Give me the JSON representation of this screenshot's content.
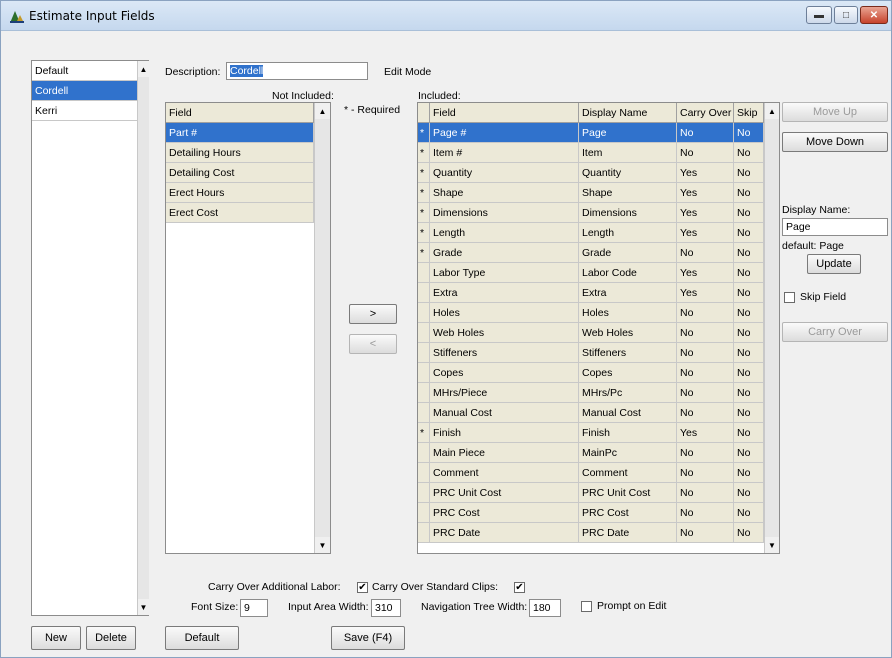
{
  "window": {
    "title": "Estimate Input Fields"
  },
  "templates": {
    "items": [
      "Default",
      "Cordell",
      "Kerri"
    ],
    "selected_index": 1
  },
  "description": {
    "label": "Description:",
    "value": "Cordell",
    "mode": "Edit Mode"
  },
  "not_included": {
    "label": "Not Included:",
    "header": "Field",
    "items": [
      "Part #",
      "Detailing Hours",
      "Detailing Cost",
      "Erect Hours",
      "Erect Cost"
    ],
    "selected_index": 0
  },
  "required_note": "* - Required",
  "move_buttons": {
    "include": ">",
    "exclude": "<"
  },
  "included": {
    "label": "Included:",
    "headers": [
      "Field",
      "Display Name",
      "Carry Over",
      "Skip"
    ],
    "rows": [
      {
        "req": "*",
        "field": "Page #",
        "display": "Page",
        "carry": "No",
        "skip": "No"
      },
      {
        "req": "*",
        "field": "Item #",
        "display": "Item",
        "carry": "No",
        "skip": "No"
      },
      {
        "req": "*",
        "field": "Quantity",
        "display": "Quantity",
        "carry": "Yes",
        "skip": "No"
      },
      {
        "req": "*",
        "field": "Shape",
        "display": "Shape",
        "carry": "Yes",
        "skip": "No"
      },
      {
        "req": "*",
        "field": "Dimensions",
        "display": "Dimensions",
        "carry": "Yes",
        "skip": "No"
      },
      {
        "req": "*",
        "field": "Length",
        "display": "Length",
        "carry": "Yes",
        "skip": "No"
      },
      {
        "req": "*",
        "field": "Grade",
        "display": "Grade",
        "carry": "No",
        "skip": "No"
      },
      {
        "req": "",
        "field": "Labor Type",
        "display": "Labor Code",
        "carry": "Yes",
        "skip": "No"
      },
      {
        "req": "",
        "field": "Extra",
        "display": "Extra",
        "carry": "Yes",
        "skip": "No"
      },
      {
        "req": "",
        "field": "Holes",
        "display": "Holes",
        "carry": "No",
        "skip": "No"
      },
      {
        "req": "",
        "field": "Web Holes",
        "display": "Web Holes",
        "carry": "No",
        "skip": "No"
      },
      {
        "req": "",
        "field": "Stiffeners",
        "display": "Stiffeners",
        "carry": "No",
        "skip": "No"
      },
      {
        "req": "",
        "field": "Copes",
        "display": "Copes",
        "carry": "No",
        "skip": "No"
      },
      {
        "req": "",
        "field": "MHrs/Piece",
        "display": "MHrs/Pc",
        "carry": "No",
        "skip": "No"
      },
      {
        "req": "",
        "field": "Manual Cost",
        "display": "Manual Cost",
        "carry": "No",
        "skip": "No"
      },
      {
        "req": "*",
        "field": "Finish",
        "display": "Finish",
        "carry": "Yes",
        "skip": "No"
      },
      {
        "req": "",
        "field": "Main Piece",
        "display": "MainPc",
        "carry": "No",
        "skip": "No"
      },
      {
        "req": "",
        "field": "Comment",
        "display": "Comment",
        "carry": "No",
        "skip": "No"
      },
      {
        "req": "",
        "field": "PRC Unit Cost",
        "display": "PRC Unit Cost",
        "carry": "No",
        "skip": "No"
      },
      {
        "req": "",
        "field": "PRC Cost",
        "display": "PRC Cost",
        "carry": "No",
        "skip": "No"
      },
      {
        "req": "",
        "field": "PRC Date",
        "display": "PRC Date",
        "carry": "No",
        "skip": "No"
      }
    ],
    "selected_index": 0
  },
  "side": {
    "move_up": "Move Up",
    "move_down": "Move Down",
    "display_name_label": "Display Name:",
    "display_name_value": "Page",
    "default_text": "default: Page",
    "update": "Update",
    "skip_field": "Skip Field",
    "carry_over": "Carry Over"
  },
  "options": {
    "carry_labor_label": "Carry Over Additional Labor:",
    "carry_labor_checked": true,
    "carry_clips_label": "Carry Over Standard Clips:",
    "carry_clips_checked": true,
    "font_size_label": "Font Size:",
    "font_size_value": "9",
    "input_width_label": "Input Area Width:",
    "input_width_value": "310",
    "nav_width_label": "Navigation Tree Width:",
    "nav_width_value": "180",
    "prompt_label": "Prompt on Edit",
    "prompt_checked": false
  },
  "footer": {
    "new": "New",
    "delete": "Delete",
    "default": "Default",
    "save": "Save (F4)"
  }
}
